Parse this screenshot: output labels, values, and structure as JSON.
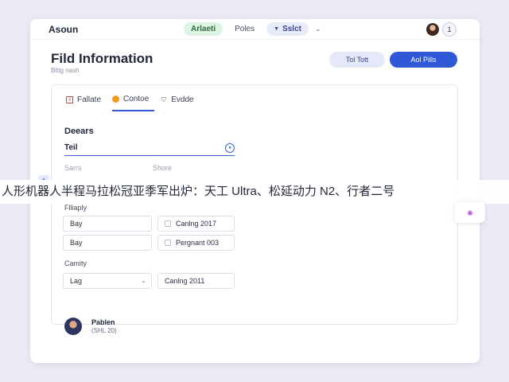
{
  "topbar": {
    "brand": "Asoun",
    "nav": {
      "active_label": "Arlaeti",
      "second_label": "Poles",
      "select_label": "Sslct",
      "select_icon": "triangle-down-icon",
      "chevron_icon": "chevron-down-icon"
    },
    "count_badge": "1"
  },
  "header": {
    "title": "Fild Information",
    "subtitle": "Bittg nash",
    "secondary_button": "Tol Tott",
    "primary_button": "Aol Pills"
  },
  "tabs": [
    {
      "label": "Fallate",
      "icon": "document-icon",
      "icon_color": "#d13d3d"
    },
    {
      "label": "Contoe",
      "icon": "dot-icon",
      "icon_color": "#f09a1e"
    },
    {
      "label": "Evdde",
      "icon": "shield-icon",
      "icon_color": "#5a5f70"
    }
  ],
  "form": {
    "section_title": "Deears",
    "main_input_value": "Teil",
    "label_left": "Sarrs",
    "label_right": "Shore",
    "group_label_1": "Flliaply",
    "row1_left": "Bay",
    "row1_right": "Canlng 2017",
    "row2_left": "Bay",
    "row2_right": "Pergnant 003",
    "group_label_2": "Camity",
    "dropdown_value": "Lag",
    "date_value": "Canlng 2011"
  },
  "person": {
    "name": "Pablen",
    "meta": "(SHL 20)"
  },
  "ticker": {
    "text": "人形机器人半程马拉松冠亚季军出炉：天工 Ultra、松延动力 N2、行者二号"
  },
  "colors": {
    "accent": "#2f58d6",
    "background": "#ecebf5",
    "active_nav": "#dff3e4"
  }
}
